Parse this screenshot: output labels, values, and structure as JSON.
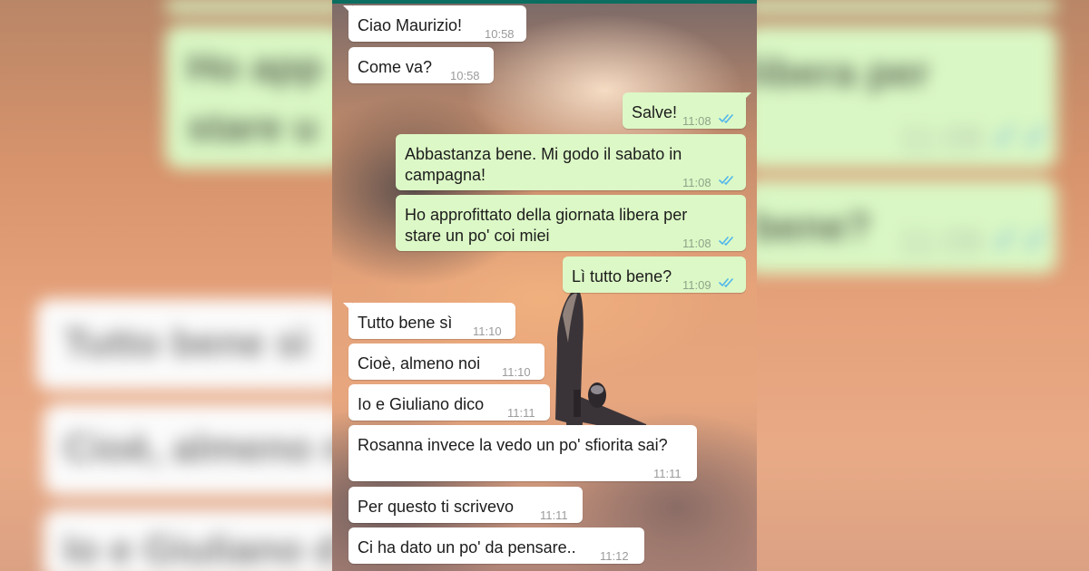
{
  "chat": {
    "messages": [
      {
        "dir": "in",
        "text": "Ciao Maurizio!",
        "time": "10:58"
      },
      {
        "dir": "in",
        "text": "Come va?",
        "time": "10:58"
      },
      {
        "dir": "out",
        "text": "Salve!",
        "time": "11:08",
        "status": "read"
      },
      {
        "dir": "out",
        "text": "Abbastanza bene. Mi godo il sabato in\ncampagna!",
        "time": "11:08",
        "status": "read"
      },
      {
        "dir": "out",
        "text": "Ho approfittato della giornata libera per\nstare un po' coi miei",
        "time": "11:08",
        "status": "read"
      },
      {
        "dir": "out",
        "text": "Lì tutto bene?",
        "time": "11:09",
        "status": "read"
      },
      {
        "dir": "in",
        "text": "Tutto bene sì",
        "time": "11:10"
      },
      {
        "dir": "in",
        "text": "Cioè, almeno noi",
        "time": "11:10"
      },
      {
        "dir": "in",
        "text": "Io e Giuliano dico",
        "time": "11:11"
      },
      {
        "dir": "in",
        "text": "Rosanna invece la vedo un po' sfiorita sai?",
        "time": "11:11"
      },
      {
        "dir": "in",
        "text": "Per questo ti scrivevo",
        "time": "11:11"
      },
      {
        "dir": "in",
        "text": "Ci ha dato un po' da pensare..",
        "time": "11:12"
      }
    ]
  },
  "blurred": {
    "right_lines": [
      "libera per",
      "bene?"
    ],
    "right_times": [
      "11:08",
      "11:09"
    ],
    "left_lines": [
      "Ho app",
      "stare u",
      "Tutto bene sì",
      "Cioè, almeno n",
      "Io e Giuliano d"
    ]
  },
  "colors": {
    "bubble_out": "#dcf8c6",
    "bubble_in": "#ffffff",
    "read_tick": "#4fb6ec",
    "header": "#0b6e60"
  },
  "icons": {
    "read_receipt": "double-check-icon"
  }
}
